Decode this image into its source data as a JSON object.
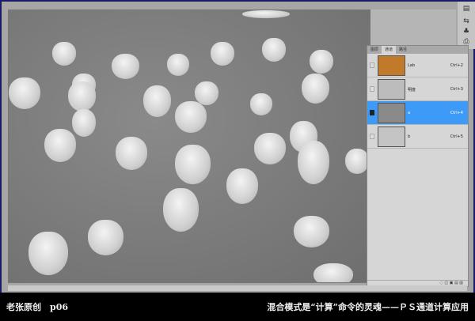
{
  "panel": {
    "tabs": [
      "图层",
      "通道",
      "路径"
    ],
    "active_tab": 1,
    "channels": [
      {
        "name": "Lab",
        "shortcut": "Ctrl+2",
        "visible": false,
        "selected": false,
        "thumb": "#c07a2a"
      },
      {
        "name": "明度",
        "shortcut": "Ctrl+3",
        "visible": false,
        "selected": false,
        "thumb": "#bcbcbc"
      },
      {
        "name": "a",
        "shortcut": "Ctrl+4",
        "visible": true,
        "selected": true,
        "thumb": "#8a8a8a"
      },
      {
        "name": "b",
        "shortcut": "Ctrl+5",
        "visible": false,
        "selected": false,
        "thumb": "#c4c4c4"
      }
    ],
    "footer_icons": "◌ ◫ ▣ ▤ ▥"
  },
  "caption": {
    "left": "老张原创　p06",
    "right": "混合模式是“计算”命令的灵魂——ＰＳ通道计算应用"
  },
  "colors": {
    "selected": "#3d9bf7",
    "bar": "#000000"
  }
}
